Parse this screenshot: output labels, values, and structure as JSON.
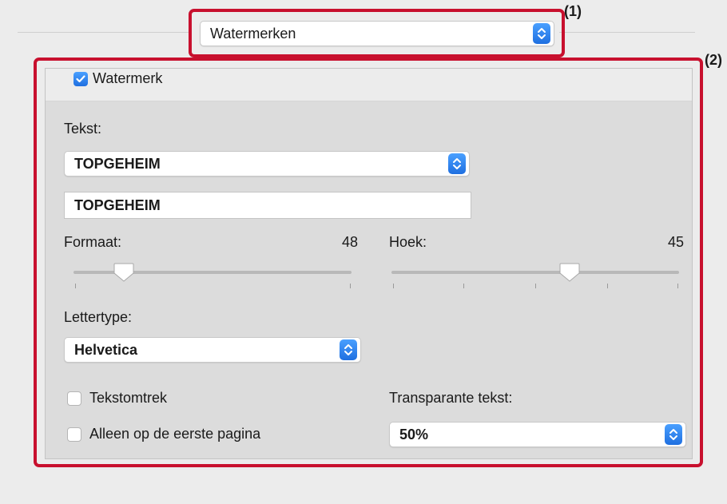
{
  "section_popup": {
    "label": "Watermerken"
  },
  "annotations": {
    "one": "(1)",
    "two": "(2)"
  },
  "watermark": {
    "enabled": true,
    "label": "Watermerk"
  },
  "text": {
    "label": "Tekst:",
    "selected": "TOPGEHEIM",
    "field_value": "TOPGEHEIM"
  },
  "size": {
    "label": "Formaat:",
    "value": "48",
    "slider_fraction": 0.18,
    "tick_count": 2
  },
  "angle": {
    "label": "Hoek:",
    "value": "45",
    "slider_fraction": 0.62,
    "tick_count": 5
  },
  "font": {
    "label": "Lettertype:",
    "selected": "Helvetica"
  },
  "outline": {
    "label": "Tekstomtrek",
    "checked": false
  },
  "first_page_only": {
    "label": "Alleen op de eerste pagina",
    "checked": false
  },
  "transparency": {
    "label": "Transparante tekst:",
    "selected": "50%"
  },
  "colors": {
    "accent": "#1f6fe0",
    "annotation_red": "#c8102e"
  }
}
